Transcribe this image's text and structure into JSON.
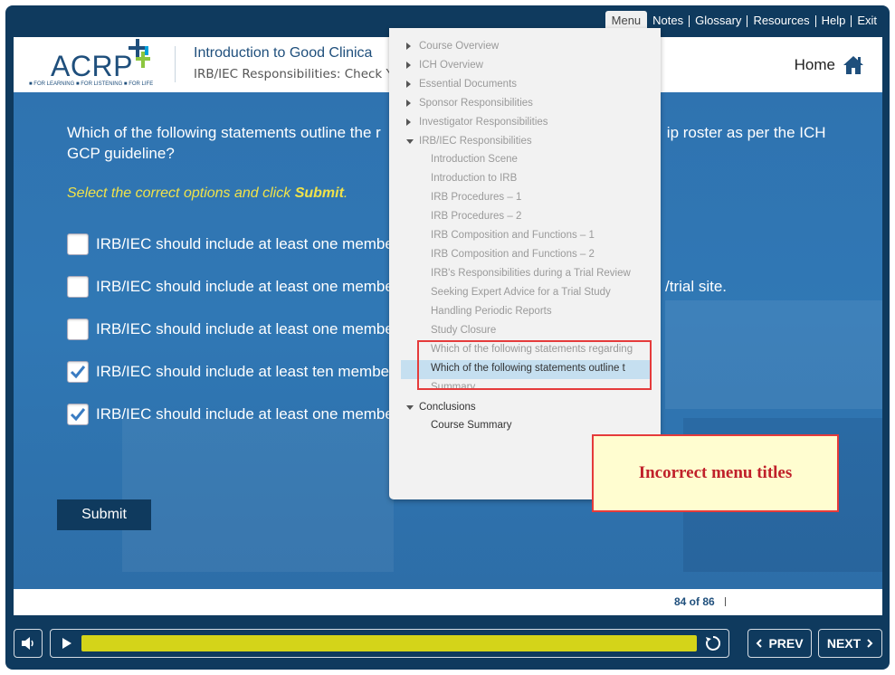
{
  "topnav": {
    "items": [
      "Menu",
      "Notes",
      "Glossary",
      "Resources",
      "Help",
      "Exit"
    ]
  },
  "header": {
    "logo_text": "ACRP",
    "logo_tagline": "■ FOR LEARNING ■ FOR LISTENING ■ FOR LIFE",
    "course_title": "Introduction to Good Clinica",
    "slide_title": "IRB/IEC Responsibilities: Check Yo",
    "home_label": "Home"
  },
  "question": {
    "text_before": "Which of the following statements outline the r",
    "text_after": "ip roster as per the ICH",
    "line2": "GCP guideline?",
    "instruction_prefix": "Select the correct options and click ",
    "instruction_bold": "Submit",
    "instruction_suffix": ".",
    "options": [
      {
        "label": "IRB/IEC should include at least one membe",
        "checked": false
      },
      {
        "label": "IRB/IEC should include at least one membe",
        "tail": "/trial site.",
        "checked": false
      },
      {
        "label": "IRB/IEC should include at least one membe",
        "checked": false
      },
      {
        "label": "IRB/IEC should include at least ten membe",
        "checked": true
      },
      {
        "label": "IRB/IEC should include at least one membe",
        "checked": true
      }
    ],
    "submit_label": "Submit"
  },
  "menu": {
    "sections": [
      {
        "label": "Course Overview"
      },
      {
        "label": "ICH Overview"
      },
      {
        "label": "Essential Documents"
      },
      {
        "label": "Sponsor Responsibilities"
      },
      {
        "label": "Investigator Responsibilities"
      },
      {
        "label": "IRB/IEC Responsibilities"
      }
    ],
    "irb_items": [
      "Introduction Scene",
      "Introduction to IRB",
      "IRB Procedures – 1",
      "IRB Procedures – 2",
      "IRB Composition and Functions – 1",
      "IRB Composition and Functions – 2",
      "IRB's Responsibilities during a Trial Review",
      "Seeking Expert Advice for a Trial Study",
      "Handling Periodic Reports",
      "Study Closure",
      "Which of the following statements regarding",
      "Which of the following statements outline t",
      "Summary"
    ],
    "conclusions_label": "Conclusions",
    "conclusions_items": [
      "Course Summary"
    ]
  },
  "annotation": {
    "note": "Incorrect menu titles"
  },
  "footer": {
    "page_count": "84 of 86"
  },
  "controls": {
    "prev_label": "PREV",
    "next_label": "NEXT",
    "progress": 1.0
  },
  "colors": {
    "navy": "#0f3a5e",
    "stage_blue": "#3078b5",
    "instruction_yellow": "#f0e24a",
    "progress_yellow": "#d4d419",
    "highlight_red": "#e53b3b"
  }
}
